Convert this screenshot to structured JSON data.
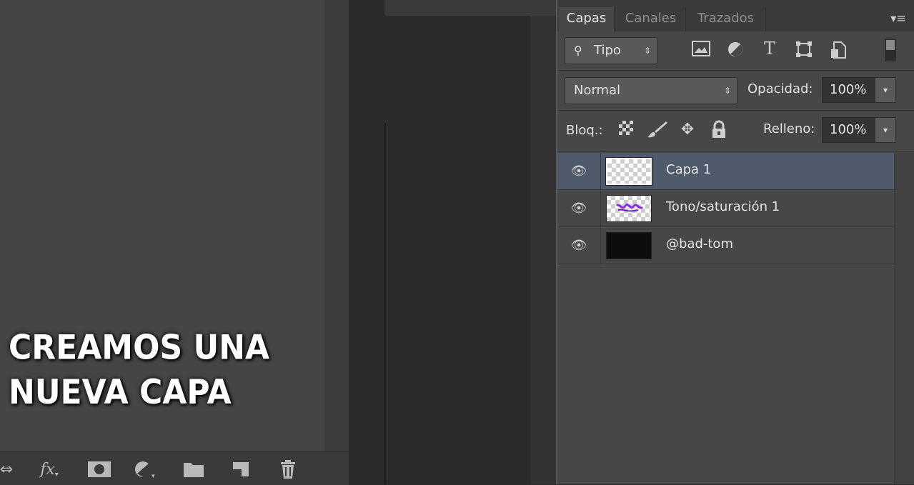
{
  "caption": {
    "line1": "CREAMOS UNA",
    "line2": "NUEVA CAPA"
  },
  "bottom_toolbar": {
    "icons": [
      "link-icon",
      "fx-icon",
      "mask-icon",
      "adjustment-icon",
      "folder-icon",
      "new-layer-icon",
      "trash-icon"
    ],
    "fx_label": "fx"
  },
  "panel": {
    "tabs": [
      {
        "label": "Capas",
        "active": true
      },
      {
        "label": "Canales",
        "active": false
      },
      {
        "label": "Trazados",
        "active": false
      }
    ],
    "filter": {
      "label": "Tipo"
    },
    "filter_icons": [
      "image-filter-icon",
      "adjustment-filter-icon",
      "type-filter-icon",
      "shape-filter-icon",
      "smart-object-filter-icon"
    ],
    "blend_mode": "Normal",
    "opacity_label": "Opacidad:",
    "opacity_value": "100%",
    "lock_label": "Bloq.:",
    "lock_icons": [
      "lock-transparent-icon",
      "lock-paint-icon",
      "lock-move-icon",
      "lock-all-icon"
    ],
    "fill_label": "Relleno:",
    "fill_value": "100%",
    "layers": [
      {
        "name": "Capa 1",
        "selected": true,
        "thumb": "transparent"
      },
      {
        "name": "Tono/saturación 1",
        "selected": false,
        "thumb": "adjustment"
      },
      {
        "name": "@bad-tom",
        "selected": false,
        "thumb": "black"
      }
    ]
  },
  "colors": {
    "panel_bg": "#474747",
    "selected_layer": "#4f5a6b",
    "workspace": "#454545"
  }
}
